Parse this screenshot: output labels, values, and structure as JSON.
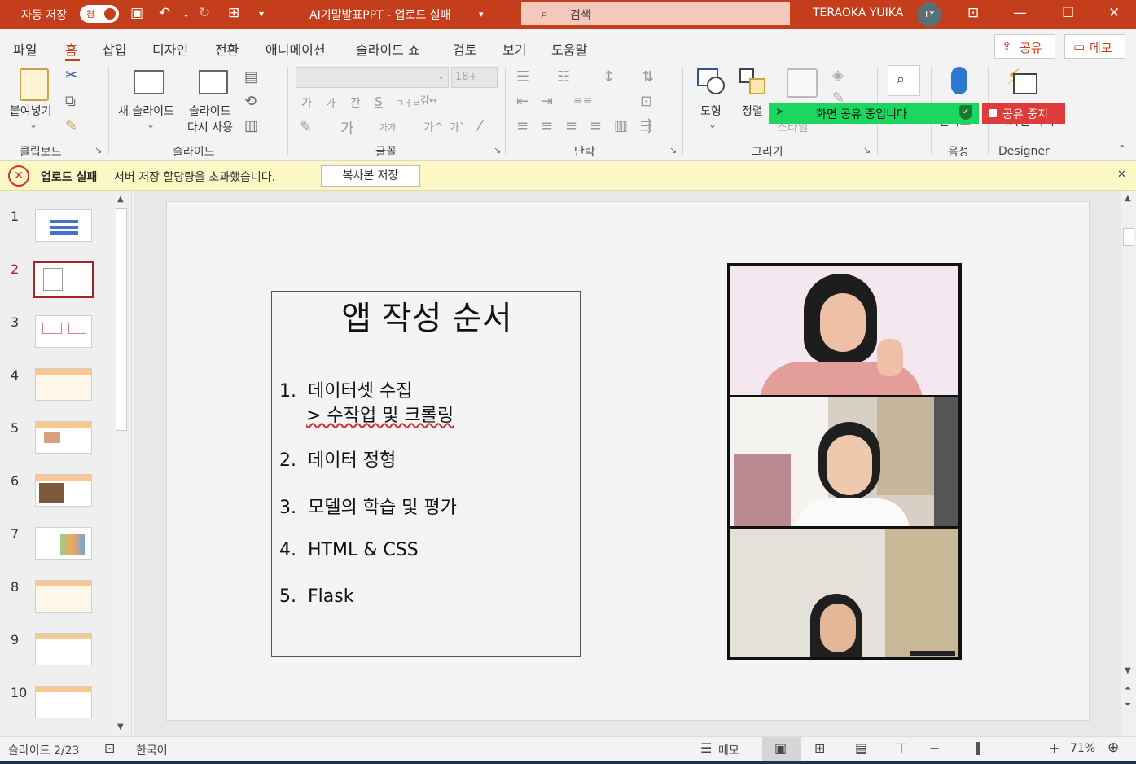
{
  "titlebar": {
    "autosave_label": "자동 저장",
    "autosave_state": "켬",
    "doc_title": "AI기말발표PPT  -  업로드 실패",
    "search_placeholder": "검색",
    "user_name": "TERAOKA YUIKA",
    "user_initials": "TY"
  },
  "menu": {
    "tabs": [
      "파일",
      "홈",
      "삽입",
      "디자인",
      "전환",
      "애니메이션",
      "슬라이드 쇼",
      "검토",
      "보기",
      "도움말"
    ],
    "active_index": 1,
    "share_label": "공유",
    "memo_label": "메모"
  },
  "ribbon": {
    "clipboard": {
      "paste_label": "붙여넣기",
      "group_label": "클립보드"
    },
    "slides": {
      "new_slide_label": "새 슬라이드",
      "reuse_line1": "슬라이드",
      "reuse_line2": "다시 사용",
      "group_label": "슬라이드"
    },
    "font": {
      "size_value": "18+",
      "group_label": "글꼴"
    },
    "paragraph": {
      "group_label": "단락"
    },
    "drawing": {
      "shapes_label": "도형",
      "arrange_label": "정렬",
      "styles_label": "스타일",
      "group_label": "그리기"
    },
    "voice": {
      "dictate_label": "받아쓰기",
      "group_label": "음성"
    },
    "designer": {
      "ideas_label": "디자인 아이디어",
      "group_label": "Designer"
    }
  },
  "screenshare": {
    "sharing_label": "화면 공유 중입니다",
    "stop_label": "공유 중지"
  },
  "notification": {
    "title": "업로드 실패",
    "message": "서버 저장 할당량을 초과했습니다.",
    "button_label": "복사본 저장"
  },
  "thumbnails": {
    "numbers": [
      "1",
      "2",
      "3",
      "4",
      "5",
      "6",
      "7",
      "8",
      "9",
      "10"
    ],
    "selected_index": 1
  },
  "slide": {
    "title": "앱 작성 순서",
    "items": [
      {
        "num": "1.",
        "text": "데이터셋 수집"
      },
      {
        "num": "",
        "text": "> 수작업 및 크롤링"
      },
      {
        "num": "2.",
        "text": "데이터 정형"
      },
      {
        "num": "3.",
        "text": "모델의 학습 및 평가"
      },
      {
        "num": "4.",
        "text": "HTML & CSS"
      },
      {
        "num": "5.",
        "text": "Flask"
      }
    ]
  },
  "statusbar": {
    "slide_counter": "슬라이드 2/23",
    "language": "한국어",
    "notes_label": "메모",
    "zoom_minus": "−",
    "zoom_plus": "+",
    "zoom_level": "71%"
  },
  "colors": {
    "accent": "#c43e1c",
    "share_green": "#1bd760",
    "stop_red": "#e03b3b",
    "notice_yellow": "#fcf7c4",
    "selected_thumb": "#a4262c"
  }
}
